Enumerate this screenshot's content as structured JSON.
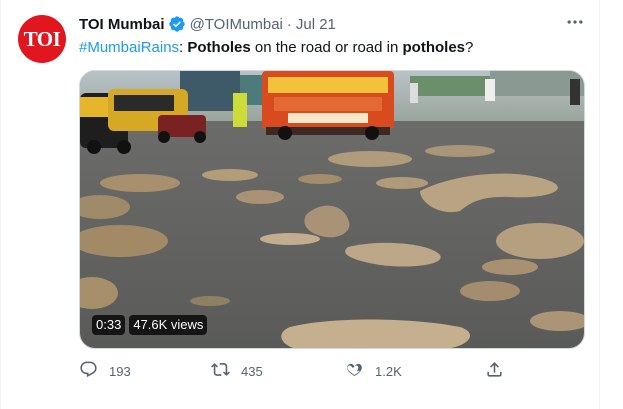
{
  "tweet": {
    "avatar_text": "TOI",
    "author_name": "TOI Mumbai",
    "handle": "@TOIMumbai",
    "separator": "·",
    "date": "Jul 21",
    "text": {
      "hashtag": "#MumbaiRains",
      "colon": ":",
      "word1": "Potholes",
      "mid": " on the road or road in ",
      "word2": "potholes",
      "end": "?"
    },
    "video": {
      "duration": "0:33",
      "views": "47.6K views"
    },
    "actions": {
      "replies": "193",
      "retweets": "435",
      "likes": "1.2K"
    }
  },
  "colors": {
    "accent": "#1d9bf0",
    "brand_red": "#e2161f",
    "muted_text": "#536471"
  },
  "icons": [
    "verified-badge-icon",
    "more-options-icon",
    "reply-icon",
    "retweet-icon",
    "like-icon",
    "share-icon"
  ]
}
